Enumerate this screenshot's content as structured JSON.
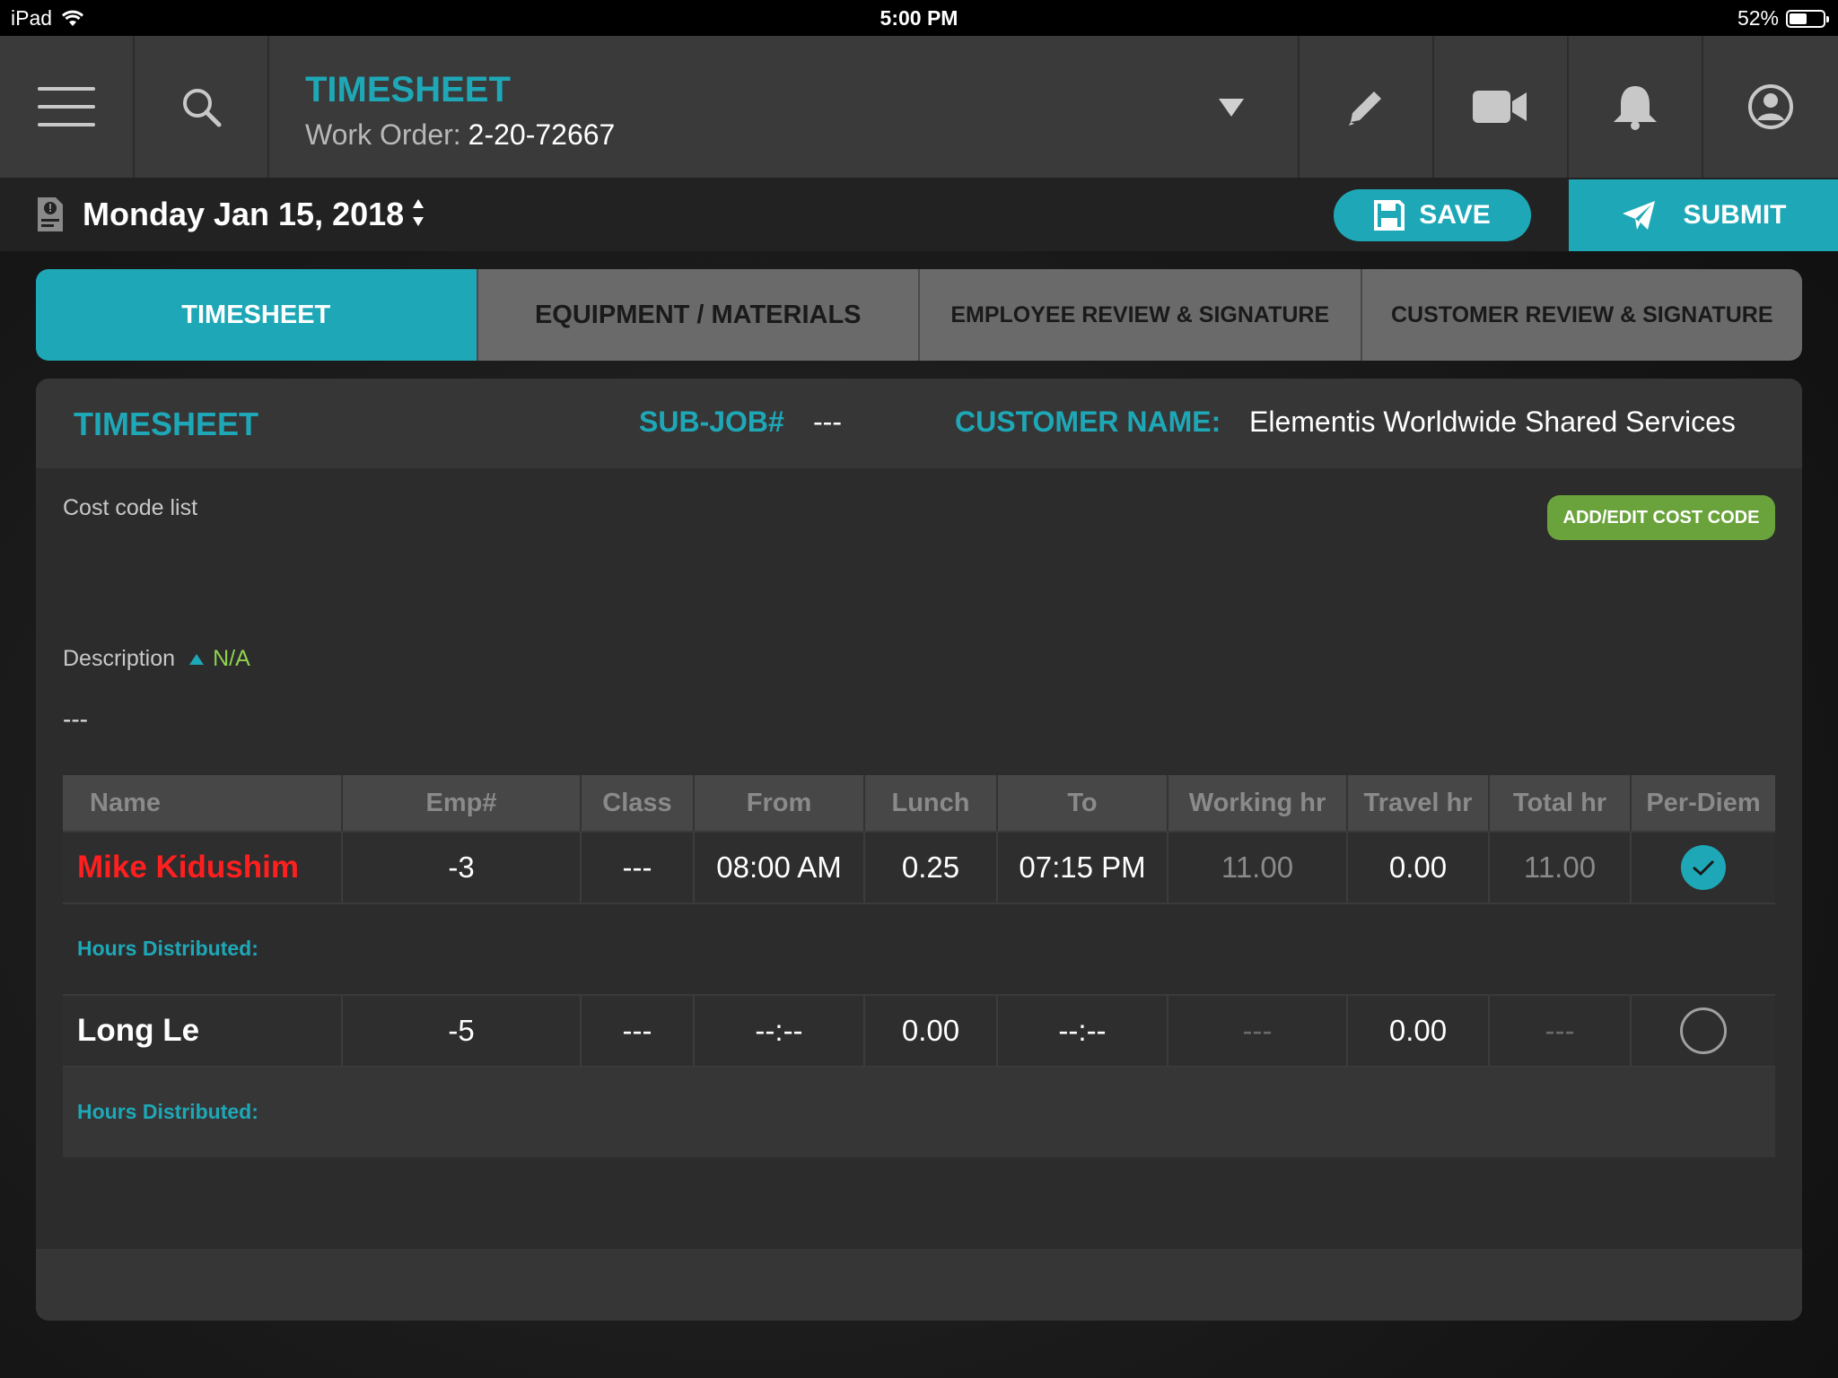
{
  "status": {
    "device": "iPad",
    "time": "5:00 PM",
    "battery": "52%",
    "battery_level": 0.52
  },
  "header": {
    "title": "TIMESHEET",
    "work_order_label": "Work Order:",
    "work_order_value": "2-20-72667",
    "icons": [
      "menu-icon",
      "search-icon",
      "chevron-down-icon",
      "pencil-icon",
      "video-icon",
      "bell-icon",
      "user-icon"
    ]
  },
  "datebar": {
    "date": "Monday Jan 15, 2018",
    "save_label": "SAVE",
    "submit_label": "SUBMIT"
  },
  "tabs": [
    {
      "label": "TIMESHEET",
      "active": true
    },
    {
      "label": "EQUIPMENT / MATERIALS",
      "active": false
    },
    {
      "label": "EMPLOYEE REVIEW & SIGNATURE",
      "active": false
    },
    {
      "label": "CUSTOMER REVIEW & SIGNATURE",
      "active": false
    }
  ],
  "panel": {
    "title": "TIMESHEET",
    "subjob_label": "SUB-JOB#",
    "subjob_value": "---",
    "customer_label": "CUSTOMER NAME:",
    "customer_value": "Elementis Worldwide Shared Services",
    "cost_code_label": "Cost code list",
    "add_cost_code_label": "ADD/EDIT COST CODE",
    "description_label": "Description",
    "description_status": "N/A",
    "description_value": "---"
  },
  "table": {
    "columns": [
      "Name",
      "Emp#",
      "Class",
      "From",
      "Lunch",
      "To",
      "Working hr",
      "Travel hr",
      "Total hr",
      "Per-Diem"
    ],
    "hours_distributed_label": "Hours Distributed:",
    "rows": [
      {
        "name": "Mike Kidushim",
        "emp": "-3",
        "class": "---",
        "from": "08:00 AM",
        "lunch": "0.25",
        "to": "07:15 PM",
        "working": "11.00",
        "travel": "0.00",
        "total": "11.00",
        "per_diem": true
      },
      {
        "name": "Long Le",
        "emp": "-5",
        "class": "---",
        "from": "--:--",
        "lunch": "0.00",
        "to": "--:--",
        "working": "---",
        "travel": "0.00",
        "total": "---",
        "per_diem": false
      }
    ]
  },
  "colors": {
    "accent": "#1ea8b7",
    "green": "#6aa33b",
    "alert": "#ff1f1f"
  }
}
